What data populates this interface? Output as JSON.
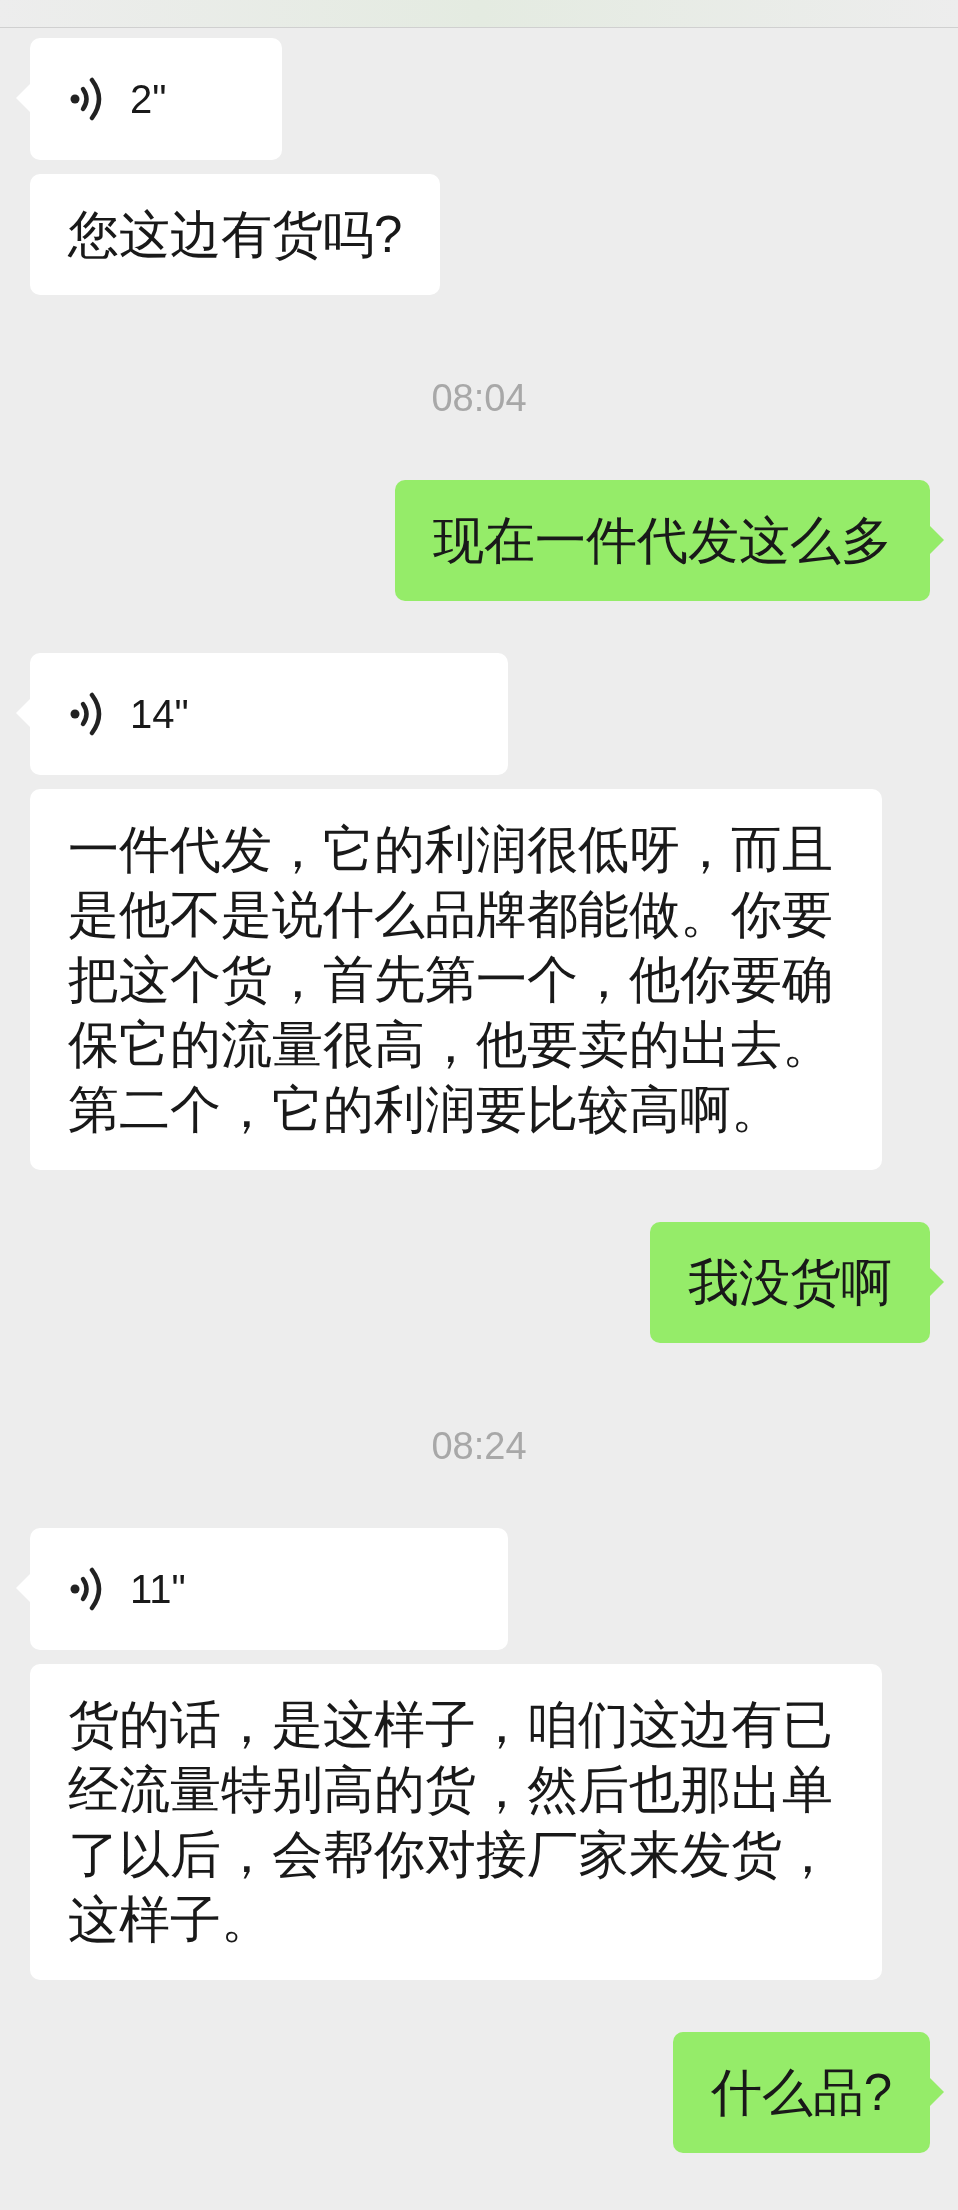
{
  "messages": [
    {
      "kind": "voice",
      "outgoing": false,
      "tail": true,
      "duration": "2\""
    },
    {
      "kind": "text",
      "outgoing": false,
      "tail": false,
      "text": "您这边有货吗?"
    },
    {
      "kind": "time",
      "text": "08:04"
    },
    {
      "kind": "text",
      "outgoing": true,
      "tail": true,
      "text": "现在一件代发这么多"
    },
    {
      "kind": "voice",
      "outgoing": false,
      "tail": true,
      "duration": "14\""
    },
    {
      "kind": "text",
      "outgoing": false,
      "tail": false,
      "text": "一件代发，它的利润很低呀，而且是他不是说什么品牌都能做。你要把这个货，首先第一个，他你要确保它的流量很高，他要卖的出去。第二个，它的利润要比较高啊。"
    },
    {
      "kind": "text",
      "outgoing": true,
      "tail": true,
      "text": "我没货啊"
    },
    {
      "kind": "time",
      "text": "08:24"
    },
    {
      "kind": "voice",
      "outgoing": false,
      "tail": true,
      "duration": "11\""
    },
    {
      "kind": "text",
      "outgoing": false,
      "tail": false,
      "text": "货的话，是这样子，咱们这边有已经流量特别高的货，然后也那出单了以后，会帮你对接厂家来发货，这样子。"
    },
    {
      "kind": "text",
      "outgoing": true,
      "tail": true,
      "text": "什么品?"
    }
  ]
}
